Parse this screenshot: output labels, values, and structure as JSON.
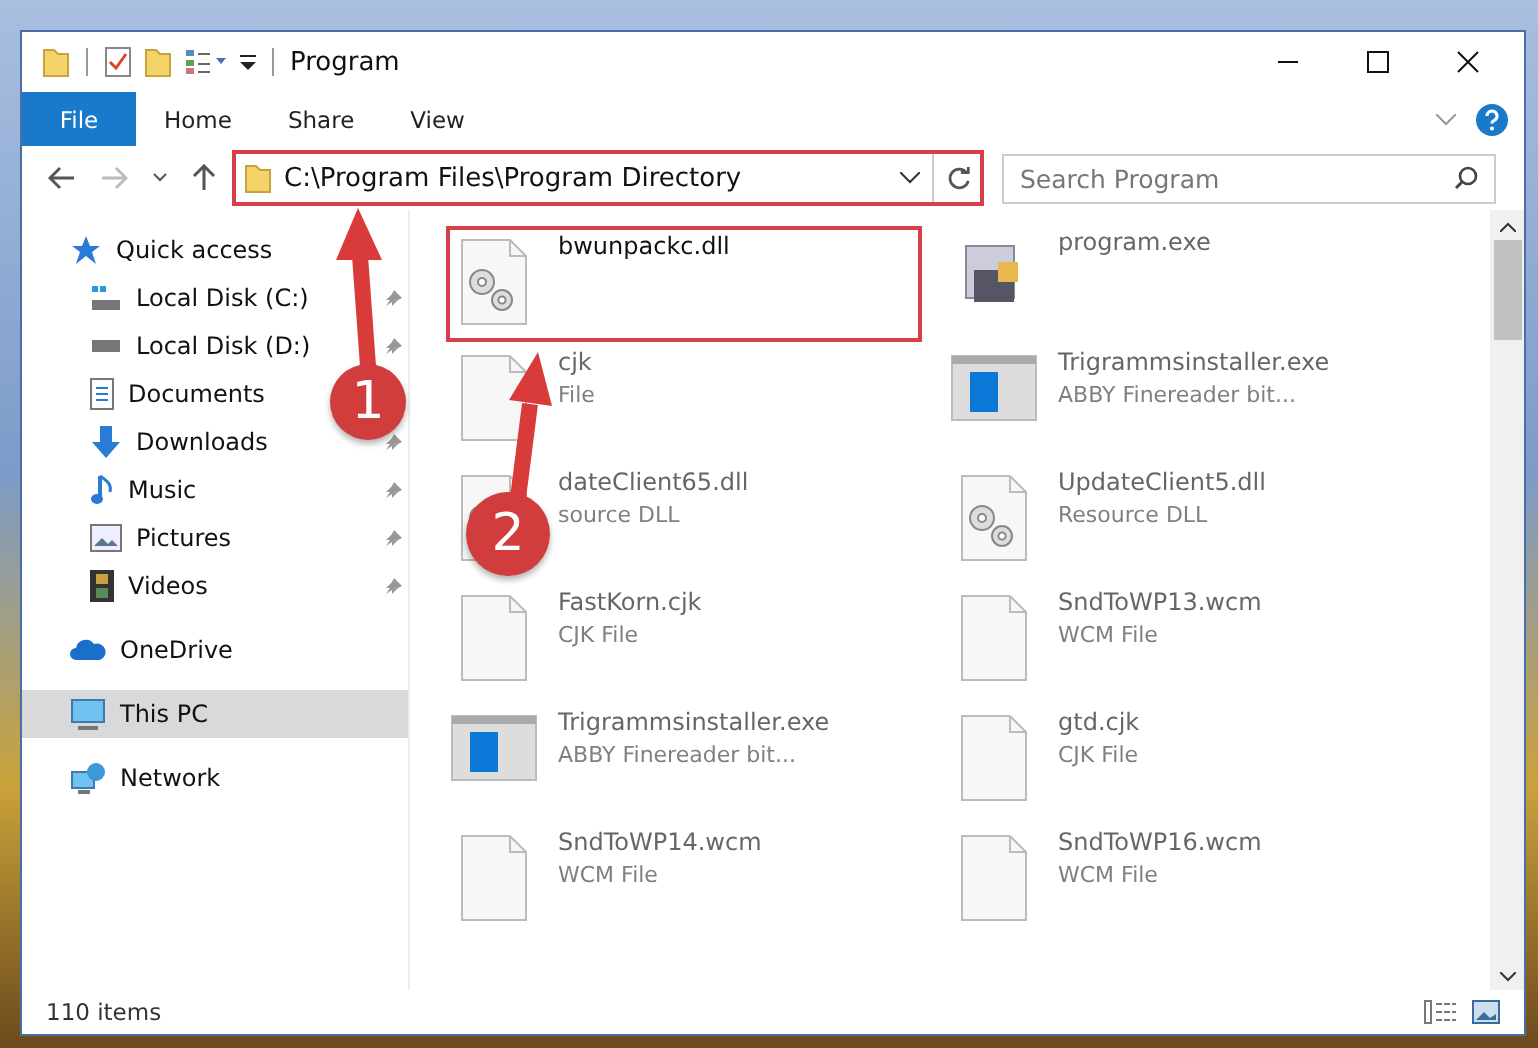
{
  "window": {
    "title": "Program"
  },
  "ribbon_tabs": [
    {
      "label": "File",
      "selected": true
    },
    {
      "label": "Home",
      "selected": false
    },
    {
      "label": "Share",
      "selected": false
    },
    {
      "label": "View",
      "selected": false
    }
  ],
  "address_bar": {
    "path": "C:\\Program Files\\Program Directory",
    "highlighted": true
  },
  "search": {
    "placeholder": "Search Program"
  },
  "sidebar": {
    "items": [
      {
        "label": "Quick access",
        "kind": "star",
        "selected": false
      },
      {
        "label": "Local Disk (C:)",
        "kind": "disk-c",
        "pinned": true,
        "selected": false
      },
      {
        "label": "Local Disk (D:)",
        "kind": "disk",
        "pinned": true,
        "selected": false
      },
      {
        "label": "Documents",
        "kind": "document",
        "selected": false
      },
      {
        "label": "Downloads",
        "kind": "download",
        "pinned": true,
        "selected": false
      },
      {
        "label": "Music",
        "kind": "music",
        "pinned": true,
        "selected": false
      },
      {
        "label": "Pictures",
        "kind": "pictures",
        "pinned": true,
        "selected": false
      },
      {
        "label": "Videos",
        "kind": "video",
        "pinned": true,
        "selected": false
      },
      {
        "label": "OneDrive",
        "kind": "cloud",
        "selected": false
      },
      {
        "label": "This PC",
        "kind": "pc",
        "selected": true
      },
      {
        "label": "Network",
        "kind": "network",
        "selected": false
      }
    ]
  },
  "files": [
    {
      "name": "bwunpackc.dll",
      "kind": "dll",
      "highlighted": true
    },
    {
      "name": "program.exe",
      "kind": "exe",
      "highlighted": false
    },
    {
      "name": "cjk",
      "type": "File",
      "kind": "blank",
      "highlighted": false
    },
    {
      "name": "Trigrammsinstaller.exe",
      "type": "ABBY Finereader bit...",
      "kind": "installer",
      "highlighted": false
    },
    {
      "name": "dateClient65.dll",
      "type": "source DLL",
      "kind": "dll",
      "highlighted": false
    },
    {
      "name": "UpdateClient5.dll",
      "type": "Resource DLL",
      "kind": "dll",
      "highlighted": false
    },
    {
      "name": "FastKorn.cjk",
      "type": "CJK File",
      "kind": "blank",
      "highlighted": false
    },
    {
      "name": "SndToWP13.wcm",
      "type": "WCM File",
      "kind": "blank",
      "highlighted": false
    },
    {
      "name": "Trigrammsinstaller.exe",
      "type": "ABBY Finereader bit...",
      "kind": "installer",
      "highlighted": false
    },
    {
      "name": "gtd.cjk",
      "type": "CJK File",
      "kind": "blank",
      "highlighted": false
    },
    {
      "name": "SndToWP14.wcm",
      "type": "WCM File",
      "kind": "blank",
      "highlighted": false
    },
    {
      "name": "SndToWP16.wcm",
      "type": "WCM File",
      "kind": "blank",
      "highlighted": false
    }
  ],
  "annotations": [
    {
      "number": "1"
    },
    {
      "number": "2"
    }
  ],
  "status_bar": {
    "count": "110 items"
  }
}
